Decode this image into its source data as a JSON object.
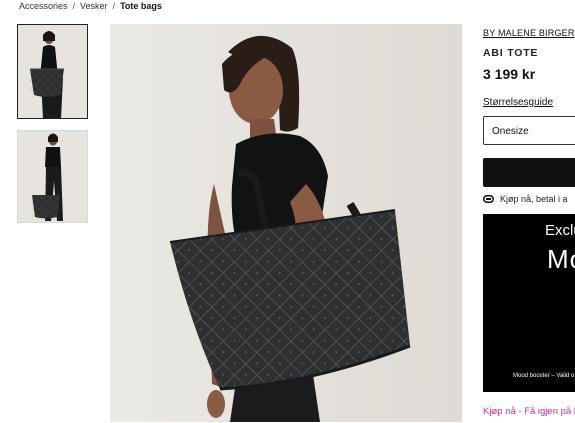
{
  "breadcrumb": {
    "items": [
      "Accessories",
      "Vesker"
    ],
    "current": "Tote bags"
  },
  "product": {
    "brand": "BY MALENE BIRGER",
    "name": "ABI TOTE",
    "price": "3 199 kr",
    "size_guide": "Størrelsesguide",
    "size_selected": "Onesize",
    "klarna_text": "Kjøp nå, betal i a",
    "bnpl_text": "Kjøp nå - Få igjen på la"
  },
  "promo": {
    "line1": "Exclu",
    "line2": "Mo",
    "footer": "Mood booster – Valid o"
  },
  "colors": {
    "accent_pink": "#e0279b",
    "button_black": "#111111",
    "promo_bg": "#000000"
  }
}
